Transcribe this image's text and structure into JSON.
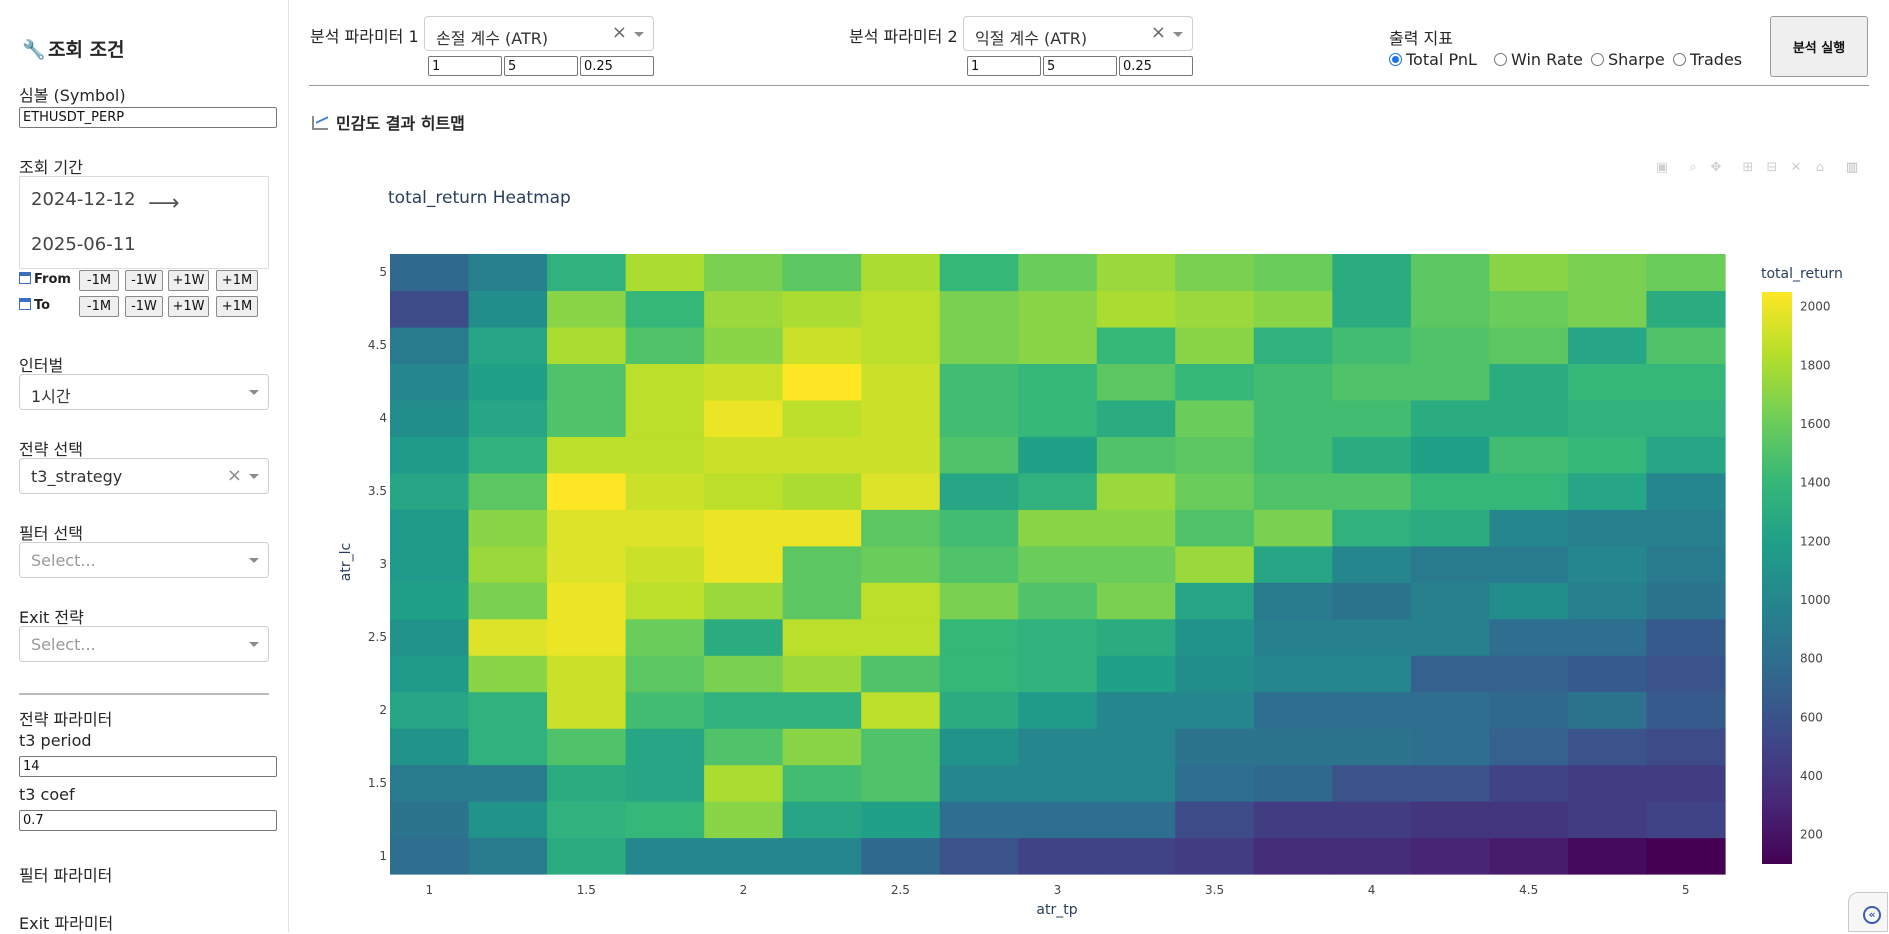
{
  "sidebar": {
    "title": "조회 조건",
    "symbol_label": "심볼 (Symbol)",
    "symbol_value": "ETHUSDT_PERP",
    "period_label": "조회 기간",
    "date_start": "2024-12-12",
    "date_end": "2025-06-11",
    "from_label": "From",
    "to_label": "To",
    "quick_buttons": [
      "-1M",
      "-1W",
      "+1W",
      "+1M"
    ],
    "interval_label": "인터벌",
    "interval_value": "1시간",
    "strategy_label": "전략 선택",
    "strategy_value": "t3_strategy",
    "filter_label": "필터 선택",
    "filter_placeholder": "Select...",
    "exit_label": "Exit 전략",
    "exit_placeholder": "Select...",
    "strategy_params_label": "전략 파라미터",
    "t3_period_label": "t3 period",
    "t3_period_value": "14",
    "t3_coef_label": "t3 coef",
    "t3_coef_value": "0.7",
    "filter_params_label": "필터 파라미터",
    "exit_params_label": "Exit 파라미터"
  },
  "topbar": {
    "param1_label": "분석 파라미터 1",
    "param1_value": "손절 계수 (ATR)",
    "param1_min": "1",
    "param1_max": "5",
    "param1_step": "0.25",
    "param2_label": "분석 파라미터 2",
    "param2_value": "익절 계수 (ATR)",
    "param2_min": "1",
    "param2_max": "5",
    "param2_step": "0.25",
    "output_label": "출력 지표",
    "radios": [
      "Total PnL",
      "Win Rate",
      "Sharpe",
      "Trades"
    ],
    "selected_radio": "Total PnL",
    "run_label": "분석 실행"
  },
  "section_title": "민감도 결과 히트맵",
  "modebar_icons": [
    "camera-icon",
    "zoom-icon",
    "pan-icon",
    "zoom-in-icon",
    "zoom-out-icon",
    "autoscale-icon",
    "home-icon",
    "plotly-logo-icon"
  ],
  "chart_data": {
    "type": "heatmap",
    "title": "total_return Heatmap",
    "xlabel": "atr_tp",
    "ylabel": "atr_lc",
    "colorbar_title": "total_return",
    "colorscale": "Viridis",
    "zmin": 100,
    "zmax": 2050,
    "x": [
      1,
      1.25,
      1.5,
      1.75,
      2,
      2.25,
      2.5,
      2.75,
      3,
      3.25,
      3.5,
      3.75,
      4,
      4.25,
      4.5,
      4.75,
      5
    ],
    "y": [
      1,
      1.25,
      1.5,
      1.75,
      2,
      2.25,
      2.5,
      2.75,
      3,
      3.25,
      3.5,
      3.75,
      4,
      4.25,
      4.5,
      4.75,
      5
    ],
    "x_ticks": [
      1,
      1.5,
      2,
      2.5,
      3,
      3.5,
      4,
      4.5,
      5
    ],
    "y_ticks": [
      1,
      1.5,
      2,
      2.5,
      3,
      3.5,
      4,
      4.5,
      5
    ],
    "colorbar_ticks": [
      200,
      400,
      600,
      800,
      1000,
      1200,
      1400,
      1600,
      1800,
      2000
    ],
    "z": [
      [
        800,
        900,
        1300,
        1000,
        1000,
        1000,
        750,
        600,
        500,
        500,
        450,
        350,
        350,
        300,
        250,
        150,
        100
      ],
      [
        850,
        1100,
        1350,
        1400,
        1700,
        1250,
        1200,
        800,
        800,
        800,
        550,
        450,
        450,
        400,
        400,
        450,
        500
      ],
      [
        900,
        900,
        1300,
        1250,
        1800,
        1450,
        1500,
        1000,
        1000,
        1000,
        800,
        750,
        600,
        600,
        500,
        450,
        450
      ],
      [
        1100,
        1350,
        1500,
        1250,
        1500,
        1700,
        1500,
        1100,
        1000,
        1000,
        850,
        850,
        850,
        800,
        700,
        600,
        550
      ],
      [
        1250,
        1350,
        1900,
        1450,
        1350,
        1350,
        1850,
        1300,
        1150,
        1000,
        1000,
        800,
        800,
        800,
        750,
        850,
        650
      ],
      [
        1150,
        1700,
        1900,
        1550,
        1650,
        1750,
        1500,
        1400,
        1350,
        1200,
        1050,
        1000,
        1000,
        700,
        700,
        650,
        600
      ],
      [
        1100,
        1950,
        2000,
        1600,
        1300,
        1850,
        1850,
        1400,
        1350,
        1300,
        1100,
        950,
        950,
        950,
        800,
        800,
        650
      ],
      [
        1200,
        1650,
        2000,
        1850,
        1750,
        1550,
        1850,
        1650,
        1500,
        1650,
        1250,
        900,
        850,
        950,
        1050,
        950,
        850
      ],
      [
        1150,
        1750,
        1950,
        1900,
        2000,
        1550,
        1600,
        1500,
        1600,
        1600,
        1750,
        1250,
        1000,
        900,
        900,
        1000,
        900
      ],
      [
        1150,
        1700,
        1950,
        1950,
        2000,
        2000,
        1550,
        1450,
        1700,
        1700,
        1500,
        1650,
        1350,
        1300,
        1000,
        950,
        950
      ],
      [
        1250,
        1550,
        2050,
        1900,
        1850,
        1800,
        1950,
        1250,
        1350,
        1750,
        1600,
        1500,
        1500,
        1400,
        1400,
        1250,
        1000
      ],
      [
        1150,
        1350,
        1850,
        1850,
        1900,
        1900,
        1900,
        1500,
        1200,
        1500,
        1550,
        1450,
        1300,
        1200,
        1450,
        1400,
        1250
      ],
      [
        1050,
        1250,
        1500,
        1850,
        2000,
        1850,
        1900,
        1450,
        1400,
        1300,
        1600,
        1450,
        1450,
        1300,
        1300,
        1350,
        1350
      ],
      [
        1000,
        1200,
        1500,
        1850,
        1900,
        2050,
        1900,
        1450,
        1400,
        1550,
        1400,
        1450,
        1500,
        1500,
        1300,
        1400,
        1400
      ],
      [
        900,
        1250,
        1800,
        1500,
        1700,
        1900,
        1850,
        1650,
        1700,
        1400,
        1700,
        1350,
        1450,
        1500,
        1550,
        1250,
        1500
      ],
      [
        550,
        1050,
        1700,
        1400,
        1750,
        1800,
        1850,
        1650,
        1700,
        1800,
        1750,
        1700,
        1300,
        1550,
        1600,
        1650,
        1300
      ],
      [
        750,
        950,
        1350,
        1800,
        1650,
        1550,
        1800,
        1400,
        1600,
        1750,
        1650,
        1600,
        1300,
        1550,
        1700,
        1650,
        1600
      ]
    ]
  }
}
